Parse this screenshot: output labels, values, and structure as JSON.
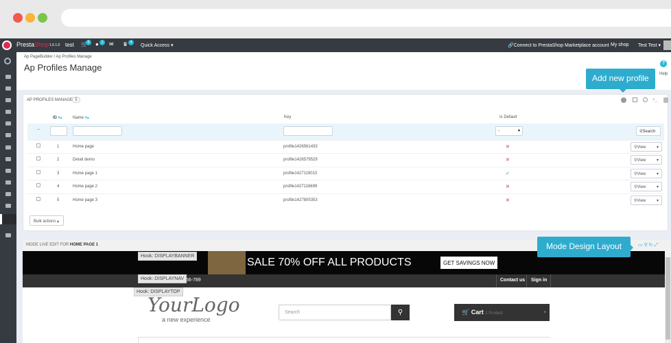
{
  "browser": {
    "dots": [
      "#f25a4d",
      "#f9b53a",
      "#7cc44c"
    ]
  },
  "topbar": {
    "brand_a": "Presta",
    "brand_b": "Shop",
    "version": "1.6.1.0",
    "shop": "test",
    "badges": [
      "5",
      "1",
      "4"
    ],
    "quick_access": "Quick Access ▾",
    "connect": "Connect to PrestaShop Marketplace account",
    "my_shop": "My shop",
    "user": "Test Test ▾"
  },
  "breadcrumb": {
    "a": "Ap PageBuilder",
    "sep": "/",
    "b": "Ap Profiles Manage"
  },
  "page_title": "Ap Profiles Manage",
  "help_label": "Help",
  "panel": {
    "title": "AP PROFILES MANAGE",
    "count": "5",
    "cols": {
      "id": "ID",
      "name": "Name",
      "key": "Key",
      "default": "Is Default"
    },
    "filter_dash": "--",
    "select_value": "-",
    "search_btn": "Search",
    "bulk": "Bulk actions ▴",
    "view": "View"
  },
  "rows": [
    {
      "id": "1",
      "name": "Home page",
      "key": "profile1426561433",
      "def": "✖"
    },
    {
      "id": "2",
      "name": "Detail demo",
      "key": "profile1426579529",
      "def": "✖"
    },
    {
      "id": "3",
      "name": "Home page 1",
      "key": "profile1427119013",
      "def": "✔"
    },
    {
      "id": "4",
      "name": "Home page 2",
      "key": "profile1427116699",
      "def": "✖"
    },
    {
      "id": "5",
      "name": "Home page 3",
      "key": "profile1427805353",
      "def": "✖"
    }
  ],
  "tooltips": {
    "add": "Add new profile",
    "design": "Mode Design Layout"
  },
  "live": {
    "label_a": "MODE LIVE EDIT FOR ",
    "label_b": "HOME PAGE 1",
    "hook_banner": "Hook: DISPLAYBANNER",
    "hook_nav": "Hook: DISPLAYNAV",
    "hook_top": "Hook: DISPLAYTOP",
    "sale": "SALE 70% OFF ALL PRODUCTS",
    "savings": "GET SAVINGS NOW",
    "phone": "456-789",
    "contact": "Contact us",
    "signin": "Sign in",
    "logo": "YourLogo",
    "tagline": "a new experience",
    "search_ph": "Search",
    "cart": "Cart",
    "cart_count": "1 Product"
  }
}
